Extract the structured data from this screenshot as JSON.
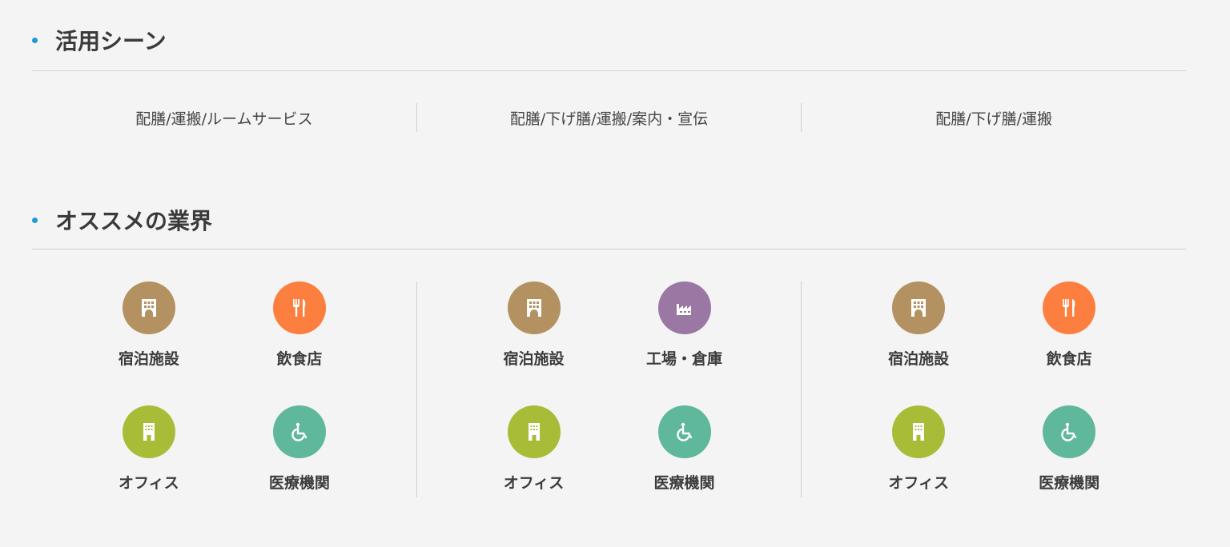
{
  "sections": {
    "scenes": {
      "title": "活用シーン"
    },
    "industries": {
      "title": "オススメの業界"
    }
  },
  "scenes": [
    "配膳/運搬/ルームサービス",
    "配膳/下げ膳/運搬/案内・宣伝",
    "配膳/下げ膳/運搬"
  ],
  "industry_columns": [
    [
      {
        "label": "宿泊施設",
        "icon": "hotel-icon",
        "color": "#b39160"
      },
      {
        "label": "飲食店",
        "icon": "restaurant-icon",
        "color": "#fc7f3f"
      },
      {
        "label": "オフィス",
        "icon": "office-icon",
        "color": "#a8bc38"
      },
      {
        "label": "医療機関",
        "icon": "accessible-icon",
        "color": "#5fb79c"
      }
    ],
    [
      {
        "label": "宿泊施設",
        "icon": "hotel-icon",
        "color": "#b39160"
      },
      {
        "label": "工場・倉庫",
        "icon": "factory-icon",
        "color": "#9b77a3"
      },
      {
        "label": "オフィス",
        "icon": "office-icon",
        "color": "#a8bc38"
      },
      {
        "label": "医療機関",
        "icon": "accessible-icon",
        "color": "#5fb79c"
      }
    ],
    [
      {
        "label": "宿泊施設",
        "icon": "hotel-icon",
        "color": "#b39160"
      },
      {
        "label": "飲食店",
        "icon": "restaurant-icon",
        "color": "#fc7f3f"
      },
      {
        "label": "オフィス",
        "icon": "office-icon",
        "color": "#a8bc38"
      },
      {
        "label": "医療機関",
        "icon": "accessible-icon",
        "color": "#5fb79c"
      }
    ]
  ],
  "colors": {
    "accent": "#1e9ad6",
    "rule": "#cfcfcf",
    "background": "#f4f4f4"
  }
}
